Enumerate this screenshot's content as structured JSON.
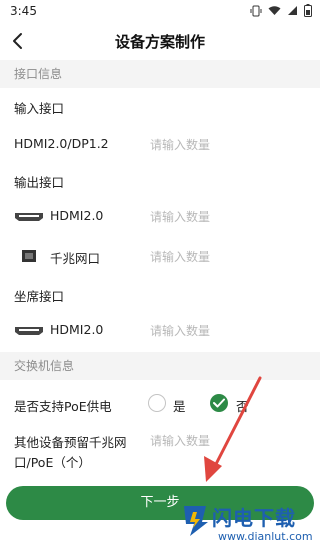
{
  "status": {
    "time": "3:45"
  },
  "header": {
    "title": "设备方案制作"
  },
  "sections": {
    "interfaces": "接口信息",
    "switch": "交换机信息"
  },
  "input": {
    "title": "输入接口",
    "hdmi_label": "HDMI2.0/DP1.2",
    "hdmi_placeholder": "请输入数量"
  },
  "output": {
    "title": "输出接口",
    "hdmi_label": "HDMI2.0",
    "hdmi_placeholder": "请输入数量",
    "eth_label": "千兆网口",
    "eth_placeholder": "请输入数量"
  },
  "seat": {
    "title": "坐席接口",
    "hdmi_label": "HDMI2.0",
    "hdmi_placeholder": "请输入数量"
  },
  "poe": {
    "question": "是否支持PoE供电",
    "yes": "是",
    "no": "否",
    "selected": "否"
  },
  "reserve": {
    "label_line1": "其他设备预留千兆网",
    "label_line2": "口/PoE（个）",
    "placeholder": "请输入数量"
  },
  "footer": {
    "next_label": "下一步"
  },
  "watermark": {
    "line1": "闪电下载",
    "line2": "www.dianlut.com"
  },
  "colors": {
    "accent": "#2d8a46",
    "section_bg": "#f4f4f4",
    "arrow": "#e0463f"
  }
}
